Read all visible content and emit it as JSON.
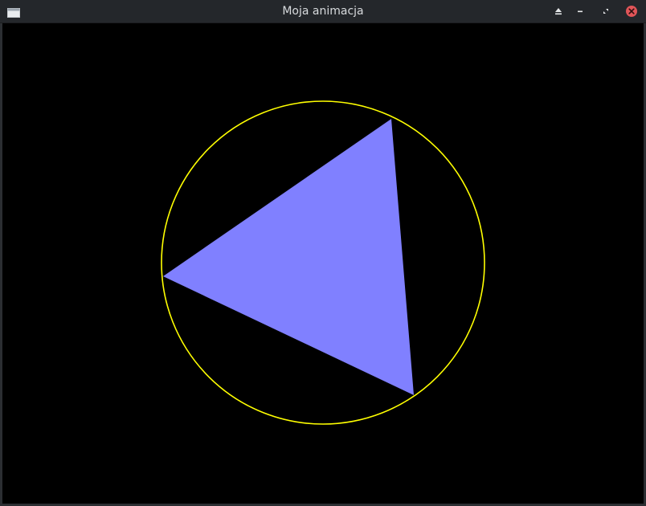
{
  "window": {
    "title": "Moja animacja"
  },
  "titlebar": {
    "app_icon": "window-icon",
    "buttons": [
      {
        "name": "keep-above",
        "icon": "eject-triangle-icon"
      },
      {
        "name": "minimize",
        "icon": "minimize-icon"
      },
      {
        "name": "maximize",
        "icon": "maximize-icon"
      },
      {
        "name": "close",
        "icon": "close-icon"
      }
    ]
  },
  "scene": {
    "background_color": "#000000",
    "circle_color": "#ffff00",
    "triangle_color": "#8080ff"
  },
  "colors": {
    "titlebar_bg": "#24272b",
    "title_text": "#d7dadd",
    "close_button": "#e05558"
  }
}
